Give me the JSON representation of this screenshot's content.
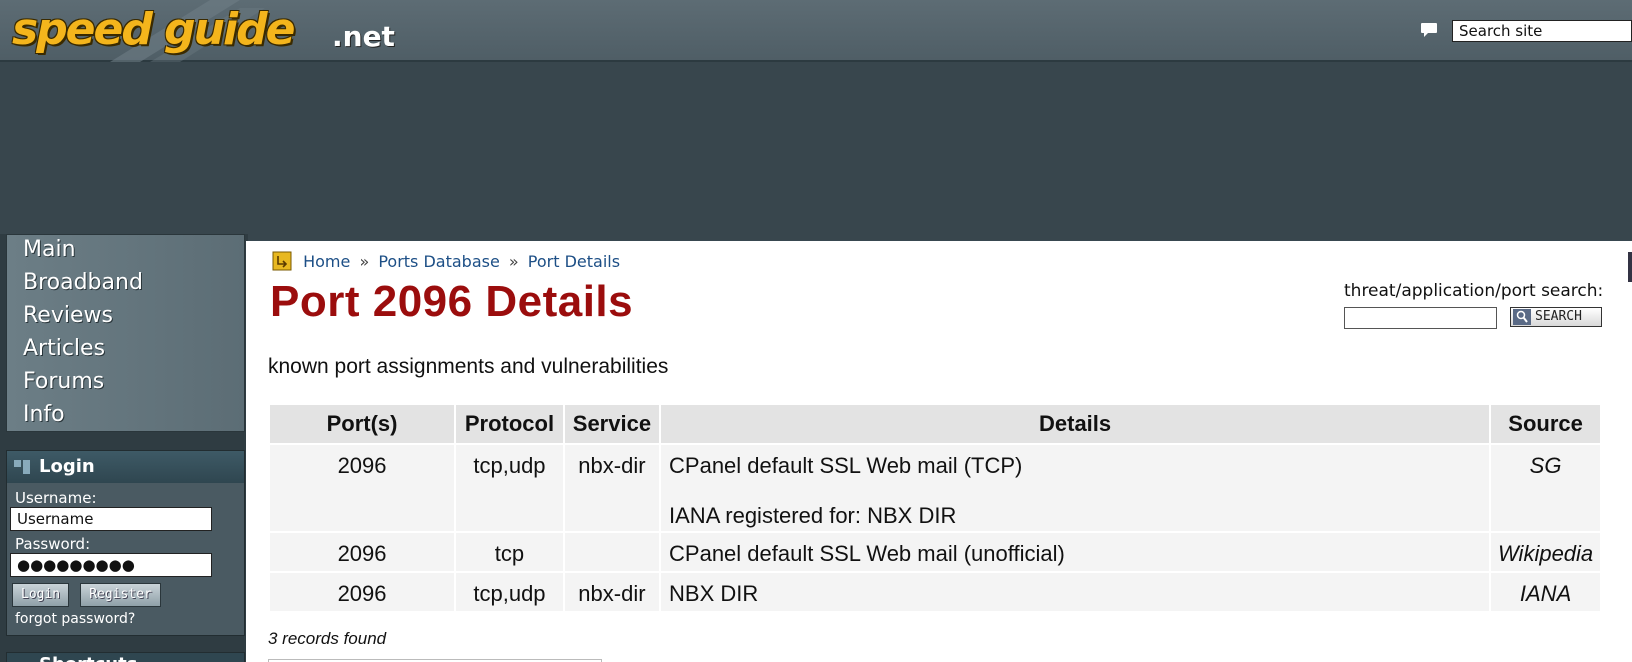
{
  "header": {
    "logo_main": "speed guide",
    "logo_tld": ".net",
    "site_search_value": "Search site"
  },
  "sidebar": {
    "nav": [
      {
        "label": "Main"
      },
      {
        "label": "Broadband"
      },
      {
        "label": "Reviews"
      },
      {
        "label": "Articles"
      },
      {
        "label": "Forums"
      },
      {
        "label": "Info"
      }
    ],
    "login": {
      "title": "Login",
      "username_label": "Username:",
      "username_value": "Username",
      "password_label": "Password:",
      "password_value": "●●●●●●●●●",
      "login_button": "Login",
      "register_button": "Register",
      "forgot_link": "forgot password?"
    },
    "next_box_title": "Shortcuts"
  },
  "breadcrumb": {
    "home": "Home",
    "sep1": "»",
    "ports_db": "Ports Database",
    "sep2": "»",
    "current": "Port Details"
  },
  "page": {
    "title": "Port 2096 Details",
    "search_label": "threat/application/port search:",
    "search_button": "SEARCH",
    "subtitle": "known port assignments and vulnerabilities",
    "records_found": "3 records found"
  },
  "table": {
    "headers": [
      "Port(s)",
      "Protocol",
      "Service",
      "Details",
      "Source"
    ],
    "rows": [
      {
        "port": "2096",
        "protocol": "tcp,udp",
        "service": "nbx-dir",
        "details_1": "CPanel default SSL Web mail (TCP)",
        "details_2": "IANA registered for: NBX DIR",
        "source": "SG"
      },
      {
        "port": "2096",
        "protocol": "tcp",
        "service": "",
        "details_1": "CPanel default SSL Web mail (unofficial)",
        "details_2": "",
        "source": "Wikipedia"
      },
      {
        "port": "2096",
        "protocol": "tcp,udp",
        "service": "nbx-dir",
        "details_1": "NBX DIR",
        "details_2": "",
        "source": "IANA"
      }
    ]
  },
  "colors": {
    "title_red": "#9b0d0d",
    "logo_gold": "#f4b51c",
    "header_bg": "#56656d",
    "link_blue": "#1d4f86"
  }
}
